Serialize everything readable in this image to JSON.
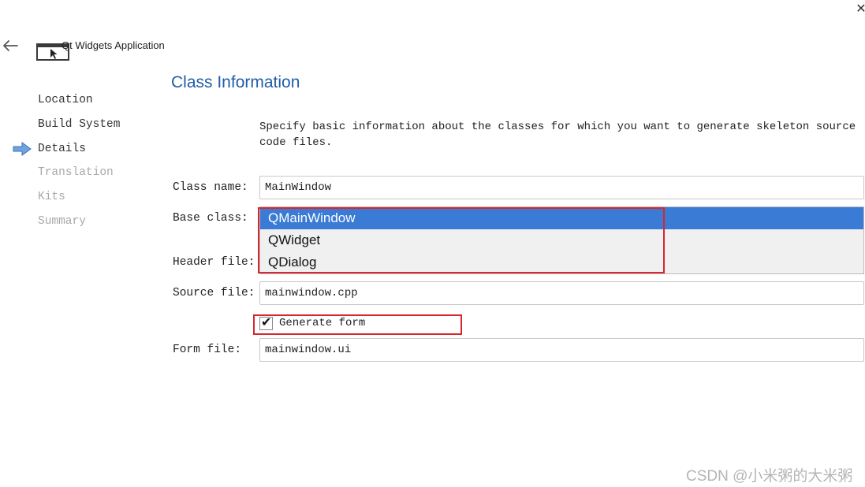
{
  "window": {
    "title": "Qt Widgets Application",
    "close_glyph": "✕"
  },
  "icons": {
    "back": "arrow-left-icon",
    "app": "qt-window-icon",
    "close": "close-icon",
    "current_step": "arrow-right-icon"
  },
  "colors": {
    "title_blue": "#1f5ea8",
    "selection_blue": "#3a7bd5",
    "highlight_red": "#d8262e",
    "disabled_gray": "#a8a8a8"
  },
  "sidebar": {
    "items": [
      {
        "label": "Location",
        "state": "done"
      },
      {
        "label": "Build System",
        "state": "done"
      },
      {
        "label": "Details",
        "state": "current"
      },
      {
        "label": "Translation",
        "state": "disabled"
      },
      {
        "label": "Kits",
        "state": "disabled"
      },
      {
        "label": "Summary",
        "state": "disabled"
      }
    ]
  },
  "page": {
    "title": "Class Information",
    "description": "Specify basic information about the classes for which you want to generate skeleton source code files."
  },
  "form": {
    "class_name": {
      "label": "Class name:",
      "value": "MainWindow"
    },
    "base_class": {
      "label": "Base class:",
      "options": [
        "QMainWindow",
        "QWidget",
        "QDialog"
      ],
      "selected": "QMainWindow"
    },
    "header_file": {
      "label": "Header file:"
    },
    "source_file": {
      "label": "Source file:",
      "value": "mainwindow.cpp"
    },
    "generate_form": {
      "label": "Generate form",
      "checked": true,
      "check_glyph": "✔"
    },
    "form_file": {
      "label": "Form file:",
      "value": "mainwindow.ui"
    }
  },
  "watermark": "CSDN @小米粥的大米粥"
}
